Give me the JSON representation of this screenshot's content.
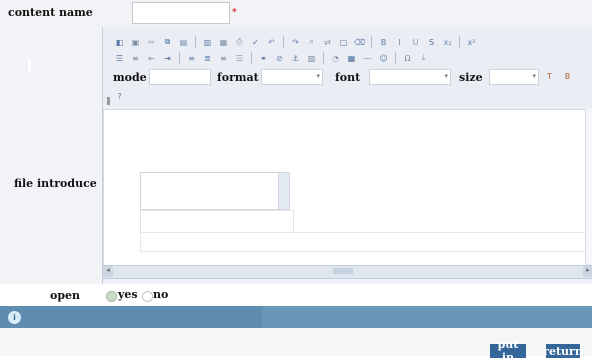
{
  "form": {
    "content_name_label": "content name",
    "content_name_value": "",
    "required_mark": "*",
    "file_introduce_label": "file introduce",
    "open_label": "open",
    "open_options": [
      {
        "label": "yes",
        "selected": true
      },
      {
        "label": "no",
        "selected": false
      }
    ]
  },
  "editor": {
    "selects": {
      "mode_label": "mode",
      "format_label": "format",
      "font_label": "font",
      "size_label": "size",
      "mode_value": "",
      "format_value": "",
      "font_value": "",
      "size_value": ""
    },
    "toolbar_row1": [
      "source-icon",
      "preview-icon",
      "cut-icon",
      "copy-icon",
      "paste-icon",
      "paste-text-icon",
      "paste-word-icon",
      "print-icon",
      "spellcheck-icon",
      "undo-icon",
      "redo-icon",
      "find-icon",
      "replace-icon",
      "select-all-icon",
      "remove-format-icon",
      "bold-icon",
      "italic-icon",
      "underline-icon",
      "strike-icon",
      "subscript-icon",
      "superscript-icon"
    ],
    "toolbar_row2": [
      "ordered-list-icon",
      "unordered-list-icon",
      "outdent-icon",
      "indent-icon",
      "align-left-icon",
      "align-center-icon",
      "align-right-icon",
      "justify-icon",
      "link-icon",
      "unlink-icon",
      "anchor-icon",
      "image-icon",
      "flash-icon",
      "table-icon",
      "rule-icon",
      "smiley-icon",
      "special-char-icon",
      "page-break-icon"
    ],
    "toolbar_row4": [
      "about-icon"
    ]
  },
  "banner": {
    "icon": "info-icon"
  },
  "footer": {
    "submit_label": "put in",
    "return_label": "return"
  }
}
